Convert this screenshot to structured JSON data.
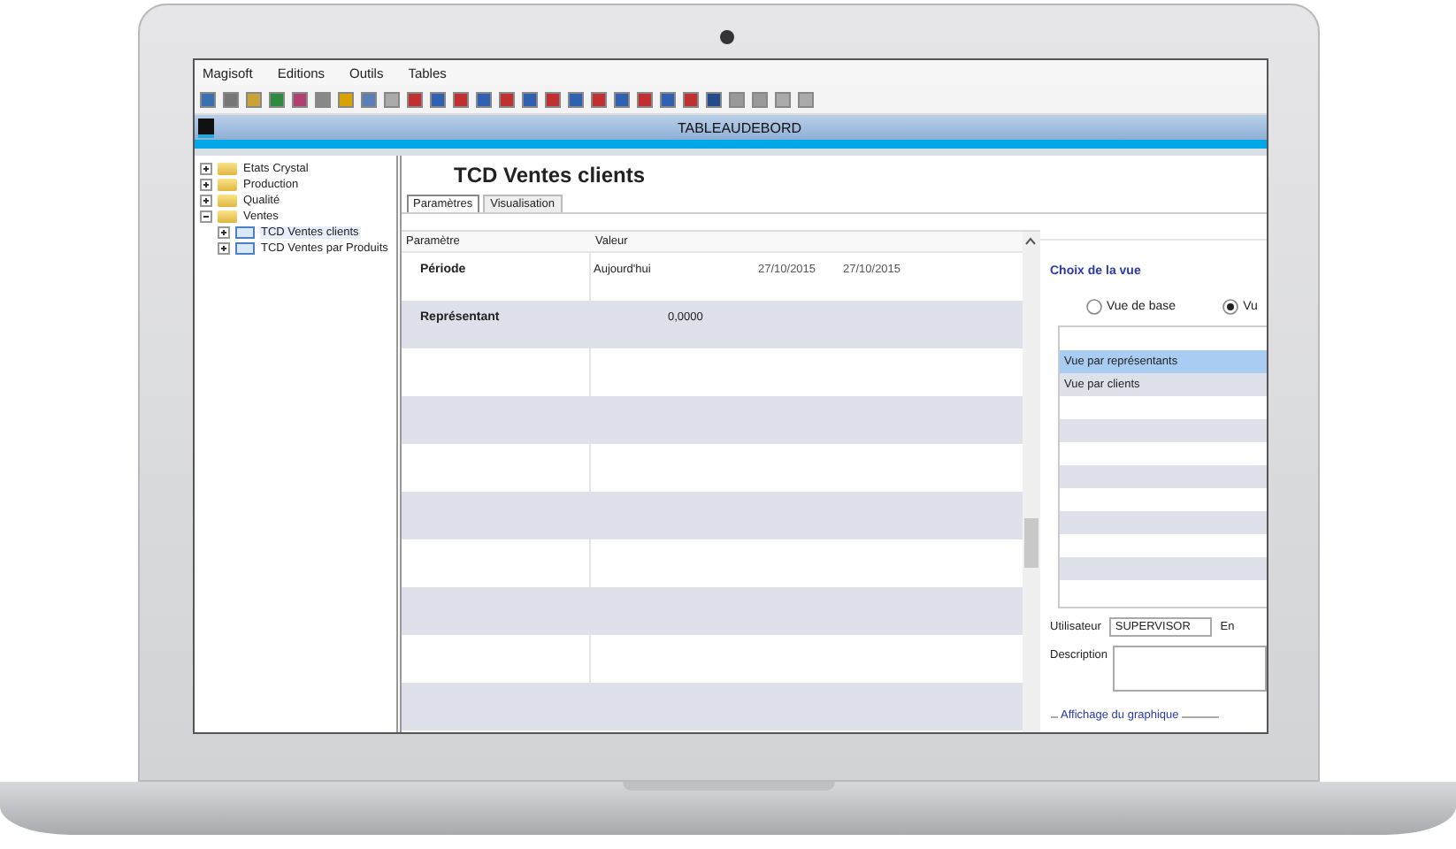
{
  "menu": [
    "Magisoft",
    "Editions",
    "Outils",
    "Tables"
  ],
  "title_bar": {
    "title": "TABLEAUDEBORD"
  },
  "tree": [
    {
      "label": "Etats Crystal",
      "kind": "folder",
      "expanded": false,
      "selected": false
    },
    {
      "label": "Production",
      "kind": "folder",
      "expanded": false,
      "selected": false
    },
    {
      "label": "Qualité",
      "kind": "folder",
      "expanded": false,
      "selected": false
    },
    {
      "label": "Ventes",
      "kind": "folder",
      "expanded": true,
      "selected": false,
      "children": [
        {
          "label": "TCD Ventes clients",
          "kind": "report",
          "expanded": false,
          "selected": true
        },
        {
          "label": "TCD Ventes par Produits",
          "kind": "report",
          "expanded": false,
          "selected": false
        }
      ]
    }
  ],
  "page_title": "TCD Ventes clients",
  "tabs": [
    {
      "label": "Paramètres",
      "selected": true
    },
    {
      "label": "Visualisation",
      "selected": false
    }
  ],
  "grid": {
    "columns": [
      "Paramètre",
      "Valeur"
    ],
    "rows": [
      {
        "name": "Période",
        "value": "Aujourd'hui",
        "date_1": "27/10/2015",
        "date_2": "27/10/2015"
      },
      {
        "name": "Représentant",
        "value": "0,0000"
      }
    ]
  },
  "view_panel": {
    "title": "Choix de la vue",
    "radios": [
      {
        "label": "Vue de base",
        "selected": false
      },
      {
        "label": "Vu",
        "selected": true
      }
    ],
    "views": [
      {
        "label": "Vue par représentants",
        "selected": true
      },
      {
        "label": "Vue par clients",
        "selected": false
      }
    ],
    "user_label": "Utilisateur",
    "user_value": "SUPERVISOR",
    "cut_label": "En",
    "description_label": "Description",
    "chart_group": "Affichage du graphique"
  }
}
